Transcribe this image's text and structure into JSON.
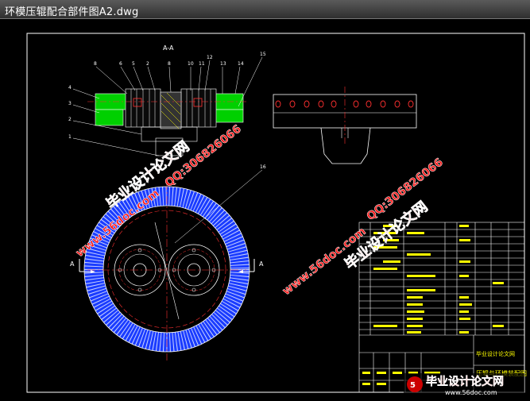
{
  "window": {
    "title": "环模压辊配合部件图A2.dwg"
  },
  "drawing": {
    "section_label": "A-A",
    "section_mark_left": "A",
    "section_mark_right": "A",
    "balloons_top": [
      "8",
      "6",
      "5",
      "2",
      "8",
      "10",
      "11",
      "12",
      "13",
      "14",
      "15"
    ],
    "balloons_left": [
      "4",
      "3",
      "2",
      "1"
    ],
    "balloon_wheel": "16",
    "title_block": {
      "company": "毕业设计论文网",
      "drawing_name": "压辊与环模装配图"
    }
  },
  "watermarks": {
    "site_text": "毕业设计论文网",
    "url": "www.56doc.com",
    "qq": "QQ:306826066",
    "corner_text": "毕业设计论文网",
    "corner_url": "www.56doc.com"
  },
  "colors": {
    "frame": "#ffffff",
    "part_fill": "#00d000",
    "rim": "#1a3cff",
    "centerline": "#ff3030",
    "hatch": "#ffff00",
    "watermark": "#ff1a1a"
  }
}
